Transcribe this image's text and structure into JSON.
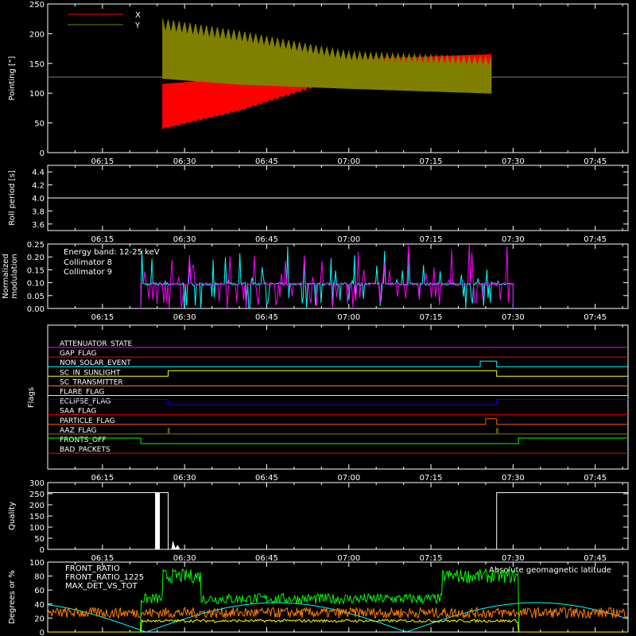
{
  "x_time_labels": [
    "06:15",
    "06:30",
    "06:45",
    "07:00",
    "07:15",
    "07:30",
    "07:45"
  ],
  "chart_data": [
    {
      "id": "pointing",
      "type": "line",
      "ylabel": "Pointing [\"]",
      "ylim": [
        0,
        250
      ],
      "yticks": [
        0,
        50,
        100,
        150,
        200,
        250
      ],
      "xlim": [
        "06:05",
        "07:51"
      ],
      "legend": "top-left",
      "series": [
        {
          "name": "X",
          "color": "#ff0000",
          "envelope_time": [
            "06:26",
            "06:40",
            "07:00",
            "07:26"
          ],
          "envelope_low": [
            40,
            70,
            128,
            140
          ],
          "envelope_high": [
            115,
            125,
            156,
            165
          ]
        },
        {
          "name": "Y",
          "color": "#808000",
          "envelope_time": [
            "06:26",
            "06:40",
            "07:00",
            "07:26"
          ],
          "envelope_low": [
            125,
            115,
            108,
            100
          ],
          "envelope_high": [
            225,
            205,
            170,
            160
          ]
        }
      ],
      "reference_line": 127
    },
    {
      "id": "roll",
      "type": "line",
      "ylabel": "Roll period [s]",
      "ylim": [
        3.5,
        4.5
      ],
      "yticks": [
        "3.6",
        "3.8",
        "4.0",
        "4.2",
        "4.4"
      ],
      "series": [
        {
          "color": "#ffffff",
          "time": [
            "06:05",
            "07:51"
          ],
          "value": [
            4.0,
            4.0
          ]
        }
      ]
    },
    {
      "id": "modulation",
      "type": "line",
      "ylabel": [
        "Normalized",
        "modulation"
      ],
      "ylim": [
        0,
        0.25
      ],
      "yticks": [
        "0.00",
        "0.05",
        "0.10",
        "0.15",
        "0.20",
        "0.25"
      ],
      "annotation": "Energy band: 12-25 keV",
      "series": [
        {
          "name": "Collimator 8",
          "color": "#00ffff",
          "range": [
            "06:22",
            "07:30"
          ],
          "baseline": 0.095
        },
        {
          "name": "Collimator 9",
          "color": "#ff00ff",
          "range": [
            "06:22",
            "07:30"
          ],
          "baseline": 0.095
        }
      ]
    },
    {
      "id": "flags",
      "type": "line",
      "ylabel": "Flags",
      "flags": [
        {
          "name": "ATTENUATOR_STATE",
          "color": "#ff00ff",
          "high": []
        },
        {
          "name": "GAP_FLAG",
          "color": "#ff0000",
          "high": []
        },
        {
          "name": "NON_SOLAR_EVENT",
          "color": "#00ffff",
          "high": [
            [
              "07:24",
              "07:27"
            ]
          ]
        },
        {
          "name": "SC_IN_SUNLIGHT",
          "color": "#ffff00",
          "high": [
            [
              "06:27",
              "07:27"
            ]
          ]
        },
        {
          "name": "SC_TRANSMITTER",
          "color": "#ff8000",
          "high": []
        },
        {
          "name": "FLARE_FLAG",
          "color": "#ffff00",
          "high": []
        },
        {
          "name": "ECLIPSE_FLAG",
          "color": "#0000ff",
          "high": [
            [
              "06:05",
              "06:27"
            ],
            [
              "07:27",
              "07:51"
            ]
          ]
        },
        {
          "name": "SAA_FLAG",
          "color": "#ff0000",
          "high": []
        },
        {
          "name": "PARTICLE_FLAG",
          "color": "#ff6000",
          "high": [
            [
              "07:25",
              "07:27"
            ]
          ]
        },
        {
          "name": "AAZ_FLAG",
          "color": "#808000",
          "high": [
            [
              "06:27",
              "06:27"
            ],
            [
              "07:27",
              "07:27"
            ]
          ]
        },
        {
          "name": "FRONTS_OFF",
          "color": "#00ff00",
          "high": [
            [
              "06:05",
              "06:22"
            ],
            [
              "07:31",
              "07:51"
            ]
          ]
        },
        {
          "name": "BAD_PACKETS",
          "color": "#ff0000",
          "high": []
        }
      ]
    },
    {
      "id": "quality",
      "type": "bar",
      "ylabel": "Quality",
      "ylim": [
        0,
        300
      ],
      "yticks": [
        0,
        50,
        100,
        150,
        200,
        250,
        300
      ],
      "segments": [
        {
          "range": [
            "06:05",
            "06:27"
          ],
          "value": 255
        },
        {
          "range": [
            "07:27",
            "07:51"
          ],
          "value": 255
        }
      ]
    },
    {
      "id": "latitude",
      "type": "line",
      "ylabel": "Degrees or %",
      "ylim": [
        0,
        100
      ],
      "yticks": [
        0,
        20,
        40,
        60,
        80,
        100
      ],
      "annotation": "Absolute geomagnetic latitude",
      "series": [
        {
          "name": "FRONT_RATIO",
          "color": "#ffff00"
        },
        {
          "name": "FRONT_RATIO_1225",
          "color": "#00ff00"
        },
        {
          "name": "MAX_DET_VS_TOT",
          "color": "#ff8000"
        },
        {
          "name": "Absolute geomagnetic latitude",
          "color": "#00ffff"
        }
      ]
    }
  ]
}
